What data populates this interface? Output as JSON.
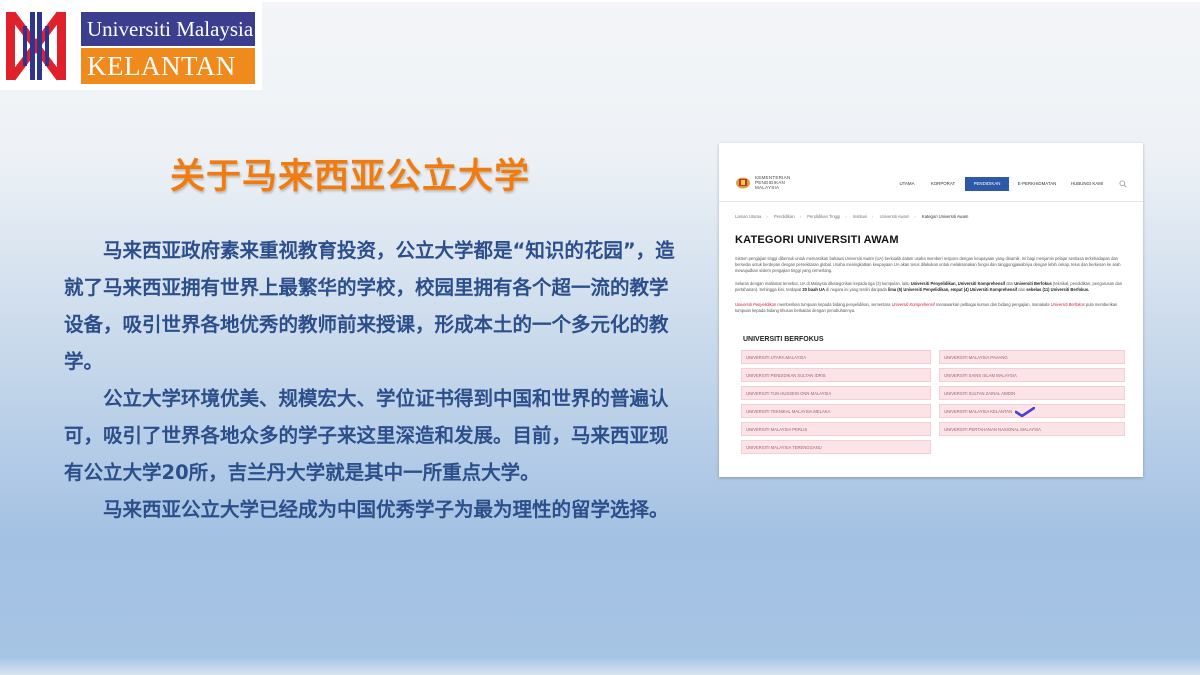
{
  "logo": {
    "line1": "Universiti Malaysia",
    "line2": "KELANTAN",
    "colors": {
      "primary": "#3b3d8e",
      "accent": "#f18a1c",
      "mark_red": "#e0202a",
      "mark_blue": "#2d3590"
    }
  },
  "slide": {
    "title": "关于马来西亚公立大学",
    "paragraphs": [
      "马来西亚政府素来重视教育投资，公立大学都是“知识的花园”，造就了马来西亚拥有世界上最繁华的学校，校园里拥有各个超一流的教学设备，吸引世界各地优秀的教师前来授课，形成本土的一个多元化的教学。",
      "公立大学环境优美、规模宏大、学位证书得到中国和世界的普遍认可，吸引了世界各地众多的学子来这里深造和发展。目前，马来西亚现有公立大学20所，吉兰丹大学就是其中一所重点大学。",
      "马来西亚公立大学已经成为中国优秀学子为最为理性的留学选择。"
    ]
  },
  "website": {
    "logo_text": [
      "KEMENTERIAN",
      "PENDIDIKAN",
      "MALAYSIA"
    ],
    "nav": [
      "UTAMA",
      "KORPORAT",
      "PENDIDIKAN",
      "E-PERKHIDMATAN",
      "HUBUNGI KAMI"
    ],
    "nav_active": "PENDIDIKAN",
    "breadcrumb": [
      "Laman Utama",
      "Pendidikan",
      "Pendidikan Tinggi",
      "Institusi",
      "Universiti Awam",
      "Kategori Universiti Awam"
    ],
    "heading": "KATEGORI UNIVERSITI AWAM",
    "para1": "Sistem pengajian tinggi dibentuk untuk memastikan bahawa Universiti Awam (UA) berkualiti dalam usaha memberi respons dengan keupayaan yang dinamik. Ini bagi menjamin pelajar sentiasa terkehadapan dan bersedia untuk berdepan dengan persekitaran global. Usaha meningkatkan keupayaan UA akan terus dilakukan untuk melaksanakan fungsi dan tanggungjawabnya dengan lebih cekap, telus dan berkesan ke arah mewujudkan sistem pengajian tinggi yang cemerlang.",
    "para2_a": "Selaras dengan matlamat tersebut, UA di Malaysia dikategorikan kepada tiga (3) kumpulan, iaitu ",
    "para2_t1": "Universiti Penyelidikan, Universiti Komprehensif",
    "para2_b": " dan ",
    "para2_t2": "Universiti Berfokus",
    "para2_c": " (teknikal, pendidikan, pengurusan dan pertahanan). Sehingga kini, terdapat ",
    "para2_t3": "20 buah UA",
    "para2_d": " di negara ini yang terdiri daripada ",
    "para2_t4": "lima (5) Universiti Penyelidikan, empat (4) Universiti Komprehensif",
    "para2_e": " dan ",
    "para2_t5": "sebelas (11) Universiti Berfokus.",
    "para3_t1": "Universiti Penyelidikan",
    "para3_a": " memberikan tumpuan kepada bidang penyelidikan, sementara ",
    "para3_t2": "Universiti Komprehensif",
    "para3_b": " menawarkan pelbagai kursus dan bidang pengajian, manakala ",
    "para3_t3": "Universiti Berfokus",
    "para3_c": " pula memberikan tumpuan kepada bidang khusus berkaitan dengan penubuhannya.",
    "section": "UNIVERSITI BERFOKUS",
    "universities_left": [
      "UNIVERSITI UTARA MALAYSIA",
      "UNIVERSITI PENDIDIKAN SULTAN IDRIS",
      "UNIVERSITI TUN HUSSEIN ONN MALAYSIA",
      "UNIVERSITI TEKNIKAL MALAYSIA MELAKA",
      "UNIVERSITI MALAYSIA PERLIS",
      "UNIVERSITI MALAYSIA TERENGGANU"
    ],
    "universities_right": [
      "UNIVERSITI MALAYSIA PAHANG",
      "UNIVERSITI SAINS ISLAM MALAYSIA",
      "UNIVERSITI SULTAN ZAINAL ABIDIN",
      "UNIVERSITI MALAYSIA KELANTAN",
      "UNIVERSITI PERTAHANAN NASIONAL MALAYSIA"
    ],
    "highlighted": "UNIVERSITI MALAYSIA KELANTAN",
    "check_icon": "check-mark-icon",
    "colors": {
      "nav_active": "#2c5aa8",
      "tag_bg": "#fbe3e7",
      "emphasis": "#c4263d",
      "check": "#4a3fcf"
    }
  }
}
